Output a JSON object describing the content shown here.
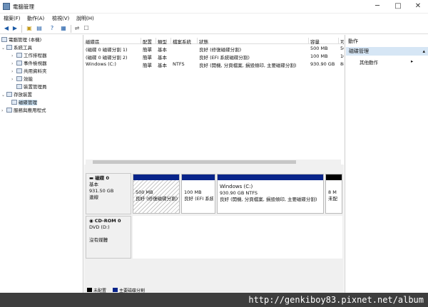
{
  "window": {
    "title": "電腦管理",
    "buttons": {
      "minimize": "─",
      "maximize": "□",
      "close": "✕"
    }
  },
  "menu": [
    "檔案(F)",
    "動作(A)",
    "檢視(V)",
    "說明(H)"
  ],
  "tree": {
    "root": "電腦管理 (本機)",
    "system_tools": "系統工具",
    "task_scheduler": "工作排程器",
    "event_viewer": "事件檢視器",
    "shared_folders": "共用資料夾",
    "performance": "效能",
    "device_manager": "裝置管理員",
    "storage": "存放裝置",
    "disk_management": "磁碟管理",
    "services": "服務與應用程式"
  },
  "volume_table": {
    "headers": [
      "磁碟區",
      "配置",
      "類型",
      "檔案系統",
      "狀態",
      "容量",
      "可"
    ],
    "rows": [
      [
        "(磁碟 0 磁碟分割 1)",
        "簡單",
        "基本",
        "",
        "良好 (修復磁碟分割)",
        "500 MB",
        "50"
      ],
      [
        "(磁碟 0 磁碟分割 2)",
        "簡單",
        "基本",
        "",
        "良好 (EFI 系統磁碟分割)",
        "100 MB",
        "10"
      ],
      [
        "Windows (C:)",
        "簡單",
        "基本",
        "NTFS",
        "良好 (開機, 分頁檔案, 損毀傾印, 主要磁碟分割)",
        "930.90 GB",
        "88"
      ]
    ]
  },
  "disk0": {
    "name": "磁碟 0",
    "type": "基本",
    "size": "931.50 GB",
    "status": "連線",
    "partitions": [
      {
        "line1": "500 MB",
        "line2": "良好 (修復磁碟分割)"
      },
      {
        "line1": "100 MB",
        "line2": "良好 (EFI 系統"
      },
      {
        "title": "Windows (C:)",
        "line1": "930.90 GB NTFS",
        "line2": "良好 (開機, 分頁檔案, 損毀傾印, 主要磁碟分割)"
      },
      {
        "line1": "8 M",
        "line2": "未配"
      }
    ]
  },
  "cdrom0": {
    "name": "CD-ROM 0",
    "drive": "DVD (D:)",
    "media": "沒有媒體"
  },
  "legend": {
    "unallocated": "未配置",
    "primary": "主要磁碟分割",
    "colors": {
      "unallocated": "#000000",
      "primary": "#08248a"
    }
  },
  "actions": {
    "title": "動作",
    "section": "磁碟管理",
    "more": "其他動作"
  },
  "watermark": "http://genkiboy83.pixnet.net/album"
}
